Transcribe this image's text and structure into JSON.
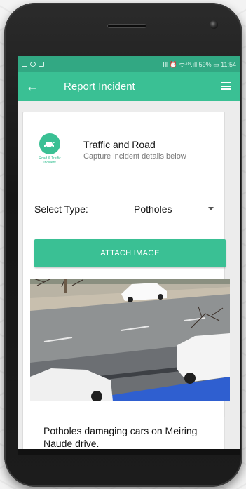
{
  "appbar": {
    "title": "Report Incident"
  },
  "statusbar": {
    "right": "ⅠⅡ ⏰ ᯤ⁴ᴳ.ıll 59% ▭ 11:54"
  },
  "header": {
    "title": "Traffic and Road",
    "subtitle": "Capture incident details below",
    "logo_text": "Road & Traffic\nIncident"
  },
  "form": {
    "select_label": "Select Type:",
    "select_value": "Potholes",
    "attach_button": "ATTACH IMAGE",
    "description": "Potholes damaging cars on Meiring Naude drive."
  },
  "colors": {
    "accent": "#3ac094",
    "statusbar": "#32a883"
  },
  "icons": {
    "back": "arrow-left",
    "menu": "hamburger",
    "logo": "car"
  }
}
